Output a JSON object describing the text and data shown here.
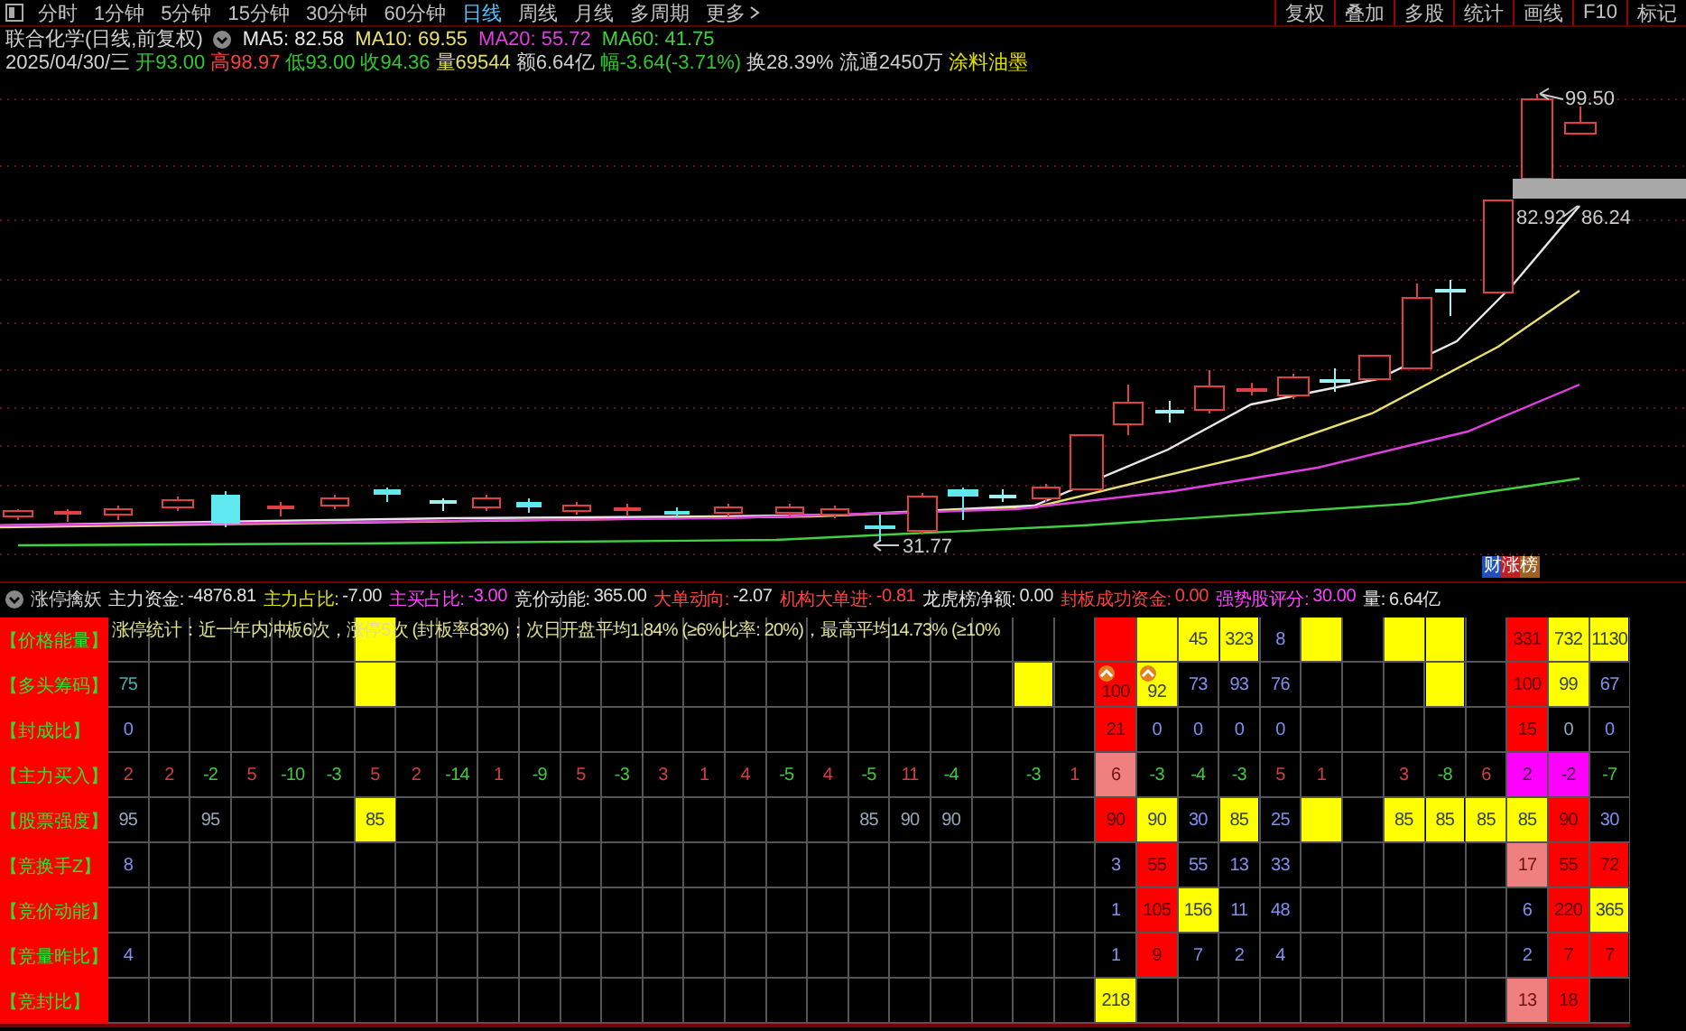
{
  "toolbar": {
    "periods": [
      {
        "label": "分时",
        "kind": "period",
        "selected": false
      },
      {
        "label": "1分钟",
        "kind": "period",
        "selected": false
      },
      {
        "label": "5分钟",
        "kind": "period",
        "selected": false
      },
      {
        "label": "15分钟",
        "kind": "period",
        "selected": false
      },
      {
        "label": "30分钟",
        "kind": "period",
        "selected": false
      },
      {
        "label": "60分钟",
        "kind": "period",
        "selected": false
      },
      {
        "label": "日线",
        "kind": "period",
        "selected": true
      },
      {
        "label": "周线",
        "kind": "period",
        "selected": false
      },
      {
        "label": "月线",
        "kind": "period",
        "selected": false
      },
      {
        "label": "多周期",
        "kind": "period",
        "selected": false
      },
      {
        "label": "更多",
        "kind": "menu",
        "selected": false
      }
    ],
    "buttons": [
      "复权",
      "叠加",
      "多股",
      "统计",
      "画线",
      "F10",
      "标记"
    ]
  },
  "info": {
    "title": "联合化学(日线,前复权)",
    "ma": [
      {
        "label": "MA5: 82.58",
        "color": "#e8e8e8"
      },
      {
        "label": "MA10: 69.55",
        "color": "#e8e070"
      },
      {
        "label": "MA20: 55.72",
        "color": "#e040e0"
      },
      {
        "label": "MA60: 41.75",
        "color": "#40d040"
      }
    ],
    "date": "2025/04/30/三",
    "quote": [
      {
        "text": "开93.00",
        "color": "#30c830"
      },
      {
        "text": "高98.97",
        "color": "#ff4040"
      },
      {
        "text": "低93.00",
        "color": "#30c830"
      },
      {
        "text": "收94.36",
        "color": "#30c830"
      },
      {
        "text": "量69544",
        "color": "#e0e060"
      },
      {
        "text": "额6.64亿",
        "color": "#d0d0d0"
      },
      {
        "text": "幅-3.64(-3.71%)",
        "color": "#30c830"
      },
      {
        "text": "换28.39%",
        "color": "#d0d0d0"
      },
      {
        "text": "流通2450万",
        "color": "#d0d0d0"
      },
      {
        "text": "涂料油墨",
        "color": "#e0e000"
      }
    ]
  },
  "chart": {
    "price_labels": [
      {
        "kind": "high",
        "text": "99.50"
      },
      {
        "kind": "last",
        "text": "82.92"
      },
      {
        "kind": "ma",
        "text": "86.24"
      },
      {
        "kind": "low",
        "text": "31.77"
      }
    ],
    "badge": "财涨榜"
  },
  "indicator": {
    "name": "涨停擒妖",
    "metrics": [
      {
        "label": "主力资金:",
        "value": "-4876.81",
        "color": "#e0e0e0",
        "kind": "white"
      },
      {
        "label": "主力占比:",
        "value": "-7.00",
        "color": "#e0e000",
        "kind": "white"
      },
      {
        "label": "主买占比:",
        "value": "-3.00",
        "color": "#ff40ff",
        "kind": "magenta"
      },
      {
        "label": "竞价动能:",
        "value": "365.00",
        "color": "#e0e0e0",
        "kind": "white"
      },
      {
        "label": "大单动向:",
        "value": "-2.07",
        "color": "#ff4040",
        "kind": "white"
      },
      {
        "label": "机构大单进:",
        "value": "-0.81",
        "color": "#ff4040",
        "kind": "red"
      },
      {
        "label": "龙虎榜净额:",
        "value": "0.00",
        "color": "#e0e0e0",
        "kind": "white"
      },
      {
        "label": "封板成功资金:",
        "value": "0.00",
        "color": "#ff4040",
        "kind": "red"
      },
      {
        "label": "强势股评分:",
        "value": "30.00",
        "color": "#ff40ff",
        "kind": "magenta"
      },
      {
        "label": "量:",
        "value": "6.64亿",
        "color": "#e0e0e0",
        "kind": "white"
      }
    ]
  },
  "grid": {
    "overlay": "涨停统计：近一年内冲板6次，涨停5次 (封板率83%)；次日开盘平均1.84% (≥6%比率: 20%)，最高平均14.73% (≥10%",
    "rows": [
      {
        "label": "【价格能量】",
        "cells": [
          {},
          {},
          {},
          {},
          {},
          {},
          {
            "color": "#ffff00"
          },
          {},
          {},
          {},
          {},
          {},
          {},
          {},
          {},
          {},
          {},
          {},
          {},
          {},
          {},
          {},
          {},
          {},
          {
            "color": "#ff0000"
          },
          {
            "color": "#ffff00"
          },
          {
            "color": "#ffff00",
            "text": "45",
            "kind": "onyellow"
          },
          {
            "color": "#ffff00",
            "text": "323",
            "kind": "onyellow"
          },
          {
            "text": "8",
            "kind": "info"
          },
          {
            "color": "#ffff00"
          },
          {},
          {
            "color": "#ffff00"
          },
          {
            "color": "#ffff00"
          },
          {},
          {
            "color": "#ff0000",
            "text": "331",
            "kind": "onred"
          },
          {
            "color": "#ffff00",
            "text": "732",
            "kind": "onyellow"
          },
          {
            "color": "#ffff00",
            "text": "1130",
            "kind": "onyellow"
          }
        ]
      },
      {
        "label": "【多头筹码】",
        "cells": [
          {
            "text": "75",
            "kind": "teal"
          },
          {},
          {},
          {},
          {},
          {},
          {
            "color": "#ffff00"
          },
          {},
          {},
          {},
          {},
          {},
          {},
          {},
          {},
          {},
          {},
          {},
          {},
          {},
          {},
          {},
          {
            "color": "#ffff00"
          },
          {},
          {
            "color": "#ff0000",
            "text": "100",
            "kind": "onred",
            "badge": true
          },
          {
            "color": "#ffff00",
            "text": "92",
            "kind": "onyellow",
            "badge": true
          },
          {
            "text": "73",
            "kind": "info"
          },
          {
            "text": "93",
            "kind": "info"
          },
          {
            "text": "76",
            "kind": "info"
          },
          {},
          {},
          {},
          {
            "color": "#ffff00"
          },
          {},
          {
            "color": "#ff0000",
            "text": "100",
            "kind": "onred"
          },
          {
            "color": "#ffff00",
            "text": "99",
            "kind": "onyellow"
          },
          {
            "text": "67",
            "kind": "info"
          }
        ]
      },
      {
        "label": "【封成比】",
        "cells": [
          {
            "text": "0",
            "kind": "info"
          },
          {},
          {},
          {},
          {},
          {},
          {},
          {},
          {},
          {},
          {},
          {},
          {},
          {},
          {},
          {},
          {},
          {},
          {},
          {},
          {},
          {},
          {},
          {},
          {
            "color": "#ff0000",
            "text": "21",
            "kind": "onred"
          },
          {
            "text": "0",
            "kind": "info"
          },
          {
            "text": "0",
            "kind": "info"
          },
          {
            "text": "0",
            "kind": "info"
          },
          {
            "text": "0",
            "kind": "info"
          },
          {},
          {},
          {},
          {},
          {},
          {
            "color": "#ff0000",
            "text": "15",
            "kind": "onred"
          },
          {
            "text": "0",
            "kind": "dim"
          },
          {
            "text": "0",
            "kind": "info"
          }
        ]
      },
      {
        "label": "【主力买入】",
        "cells": [
          {
            "text": "2",
            "kind": "up"
          },
          {
            "text": "2",
            "kind": "up"
          },
          {
            "text": "-2",
            "kind": "down"
          },
          {
            "text": "5",
            "kind": "up"
          },
          {
            "text": "-10",
            "kind": "down"
          },
          {
            "text": "-3",
            "kind": "down"
          },
          {
            "text": "5",
            "kind": "up"
          },
          {
            "text": "2",
            "kind": "up"
          },
          {
            "text": "-14",
            "kind": "down"
          },
          {
            "text": "1",
            "kind": "up"
          },
          {
            "text": "-9",
            "kind": "down"
          },
          {
            "text": "5",
            "kind": "up"
          },
          {
            "text": "-3",
            "kind": "down"
          },
          {
            "text": "3",
            "kind": "up"
          },
          {
            "text": "1",
            "kind": "up"
          },
          {
            "text": "4",
            "kind": "up"
          },
          {
            "text": "-5",
            "kind": "down"
          },
          {
            "text": "4",
            "kind": "up"
          },
          {
            "text": "-5",
            "kind": "down"
          },
          {
            "text": "11",
            "kind": "up"
          },
          {
            "text": "-4",
            "kind": "down"
          },
          {},
          {
            "text": "-3",
            "kind": "down"
          },
          {
            "text": "1",
            "kind": "up"
          },
          {
            "color": "#f08080",
            "text": "6",
            "kind": "onpink"
          },
          {
            "text": "-3",
            "kind": "down"
          },
          {
            "text": "-4",
            "kind": "down"
          },
          {
            "text": "-3",
            "kind": "down"
          },
          {
            "text": "5",
            "kind": "up"
          },
          {
            "text": "1",
            "kind": "up"
          },
          {},
          {
            "text": "3",
            "kind": "up"
          },
          {
            "text": "-8",
            "kind": "down"
          },
          {
            "text": "6",
            "kind": "up"
          },
          {
            "color": "#ff00ff",
            "text": "2",
            "kind": "onmagenta"
          },
          {
            "color": "#ff00ff",
            "text": "-2",
            "kind": "onmagenta"
          },
          {
            "text": "-7",
            "kind": "down"
          }
        ]
      },
      {
        "label": "【股票强度】",
        "cells": [
          {
            "text": "95",
            "kind": "dim"
          },
          {},
          {
            "text": "95",
            "kind": "dim"
          },
          {},
          {},
          {},
          {
            "color": "#ffff00",
            "text": "85",
            "kind": "onyellow"
          },
          {},
          {},
          {},
          {},
          {},
          {},
          {},
          {},
          {},
          {},
          {},
          {
            "text": "85",
            "kind": "dim"
          },
          {
            "text": "90",
            "kind": "dim"
          },
          {
            "text": "90",
            "kind": "dim"
          },
          {},
          {},
          {},
          {
            "color": "#ff0000",
            "text": "90",
            "kind": "onred"
          },
          {
            "color": "#ffff00",
            "text": "90",
            "kind": "onyellow"
          },
          {
            "text": "30",
            "kind": "info"
          },
          {
            "color": "#ffff00",
            "text": "85",
            "kind": "onyellow"
          },
          {
            "text": "25",
            "kind": "info"
          },
          {
            "color": "#ffff00"
          },
          {},
          {
            "color": "#ffff00",
            "text": "85",
            "kind": "onyellow"
          },
          {
            "color": "#ffff00",
            "text": "85",
            "kind": "onyellow"
          },
          {
            "color": "#ffff00",
            "text": "85",
            "kind": "onyellow"
          },
          {
            "color": "#ffff00",
            "text": "85",
            "kind": "onyellow"
          },
          {
            "color": "#ff0000",
            "text": "90",
            "kind": "onred"
          },
          {
            "text": "30",
            "kind": "info"
          }
        ]
      },
      {
        "label": "【竞换手Z】",
        "cells": [
          {
            "text": "8",
            "kind": "info"
          },
          {},
          {},
          {},
          {},
          {},
          {},
          {},
          {},
          {},
          {},
          {},
          {},
          {},
          {},
          {},
          {},
          {},
          {},
          {},
          {},
          {},
          {},
          {},
          {
            "text": "3",
            "kind": "info"
          },
          {
            "color": "#ff0000",
            "text": "55",
            "kind": "onred"
          },
          {
            "text": "55",
            "kind": "info"
          },
          {
            "text": "13",
            "kind": "info"
          },
          {
            "text": "33",
            "kind": "info"
          },
          {},
          {},
          {},
          {},
          {},
          {
            "color": "#f08080",
            "text": "17",
            "kind": "onpink"
          },
          {
            "color": "#ff0000",
            "text": "55",
            "kind": "onred"
          },
          {
            "color": "#ff0000",
            "text": "72",
            "kind": "onred"
          }
        ]
      },
      {
        "label": "【竞价动能】",
        "cells": [
          {},
          {},
          {},
          {},
          {},
          {},
          {},
          {},
          {},
          {},
          {},
          {},
          {},
          {},
          {},
          {},
          {},
          {},
          {},
          {},
          {},
          {},
          {},
          {},
          {
            "text": "1",
            "kind": "info"
          },
          {
            "color": "#ff0000",
            "text": "105",
            "kind": "onred"
          },
          {
            "color": "#ffff00",
            "text": "156",
            "kind": "onyellow"
          },
          {
            "text": "11",
            "kind": "info"
          },
          {
            "text": "48",
            "kind": "info"
          },
          {},
          {},
          {},
          {},
          {},
          {
            "text": "6",
            "kind": "info"
          },
          {
            "color": "#ff0000",
            "text": "220",
            "kind": "onred"
          },
          {
            "color": "#ffff00",
            "text": "365",
            "kind": "onyellow"
          }
        ]
      },
      {
        "label": "【竞量昨比】",
        "cells": [
          {
            "text": "4",
            "kind": "info"
          },
          {},
          {},
          {},
          {},
          {},
          {},
          {},
          {},
          {},
          {},
          {},
          {},
          {},
          {},
          {},
          {},
          {},
          {},
          {},
          {},
          {},
          {},
          {},
          {
            "text": "1",
            "kind": "info"
          },
          {
            "color": "#ff0000",
            "text": "9",
            "kind": "onred"
          },
          {
            "text": "7",
            "kind": "info"
          },
          {
            "text": "2",
            "kind": "info"
          },
          {
            "text": "4",
            "kind": "info"
          },
          {},
          {},
          {},
          {},
          {},
          {
            "text": "2",
            "kind": "info"
          },
          {
            "color": "#ff0000",
            "text": "7",
            "kind": "onred"
          },
          {
            "color": "#ff0000",
            "text": "7",
            "kind": "onred"
          }
        ]
      },
      {
        "label": "【竞封比】",
        "cells": [
          {},
          {},
          {},
          {},
          {},
          {},
          {},
          {},
          {},
          {},
          {},
          {},
          {},
          {},
          {},
          {},
          {},
          {},
          {},
          {},
          {},
          {},
          {},
          {},
          {
            "color": "#ffff00",
            "text": "218",
            "kind": "onyellow"
          },
          {},
          {},
          {},
          {},
          {},
          {},
          {},
          {},
          {},
          {
            "color": "#f08080",
            "text": "13",
            "kind": "onpink"
          },
          {
            "color": "#ff0000",
            "text": "18",
            "kind": "onred"
          },
          {}
        ]
      }
    ]
  }
}
